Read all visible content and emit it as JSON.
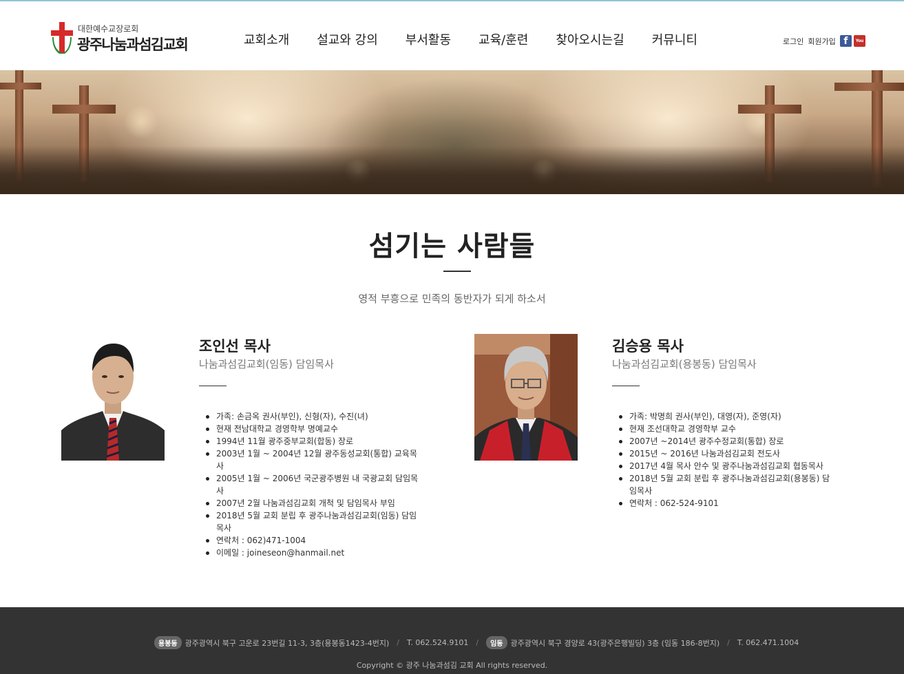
{
  "header": {
    "logo_sub": "대한예수교장로회",
    "logo_main": "광주나눔과섬김교회",
    "nav": [
      "교회소개",
      "설교와 강의",
      "부서활동",
      "교육/훈련",
      "찾아오시는길",
      "커뮤니티"
    ],
    "login": "로그인",
    "signup": "회원가입",
    "youtube_label": "You Tube"
  },
  "main": {
    "title": "섬기는 사람들",
    "subtitle": "영적 부흥으로 민족의 동반자가 되게 하소서",
    "pastors": [
      {
        "name": "조인선 목사",
        "role": "나눔과섬김교회(임동) 담임목사",
        "info": [
          "가족: 손금옥 권사(부인), 신형(자), 수진(녀)",
          "현재 전남대학교 경영학부 명예교수",
          "1994년 11월 광주중부교회(합동) 장로",
          "2003년 1월 ~ 2004년 12월 광주동성교회(통합) 교육목사",
          "2005년 1월 ~ 2006년 국군광주병원 내 국광교회 담임목사",
          "2007년 2월 나눔과섬김교회 개척 및 담임목사 부임",
          "2018년 5월 교회 분립 후 광주나눔과섬김교회(임동) 담임목사",
          "연락처 : 062)471-1004",
          "이메일 : joineseon@hanmail.net"
        ]
      },
      {
        "name": "김승용 목사",
        "role": "나눔과섬김교회(용봉동) 담임목사",
        "info": [
          "가족: 박명희 권사(부인), 대영(자), 준영(자)",
          "현재 조선대학교 경영학부 교수",
          "2007년 ~2014년 광주수정교회(통합) 장로",
          "2015년 ~ 2016년 나눔과섬김교회 전도사",
          "2017년 4월 목사 안수 및 광주나눔과섬김교회 협동목사",
          "2018년 5월 교회 분립 후 광주나눔과섬김교회(용봉동) 담임목사",
          "연락처 : 062-524-9101"
        ]
      }
    ]
  },
  "footer": {
    "branch1_badge": "용봉동",
    "branch1_address": "광주광역시 북구 고운로 23번길 11-3, 3층(용봉동1423-4번지)",
    "branch1_phone": "T. 062.524.9101",
    "branch2_badge": "임동",
    "branch2_address": "광주광역시 북구 경양로 43(광주은행빌딩) 3층 (임동 186-8번지)",
    "branch2_phone": "T. 062.471.1004",
    "copyright": "Copyright © 광주 나눔과섬김 교회 All rights reserved."
  },
  "colors": {
    "logo_red": "#d62a2a",
    "logo_green": "#2e8b3a",
    "footer_bg": "#333333",
    "facebook": "#3b5998",
    "youtube": "#c4302b"
  }
}
